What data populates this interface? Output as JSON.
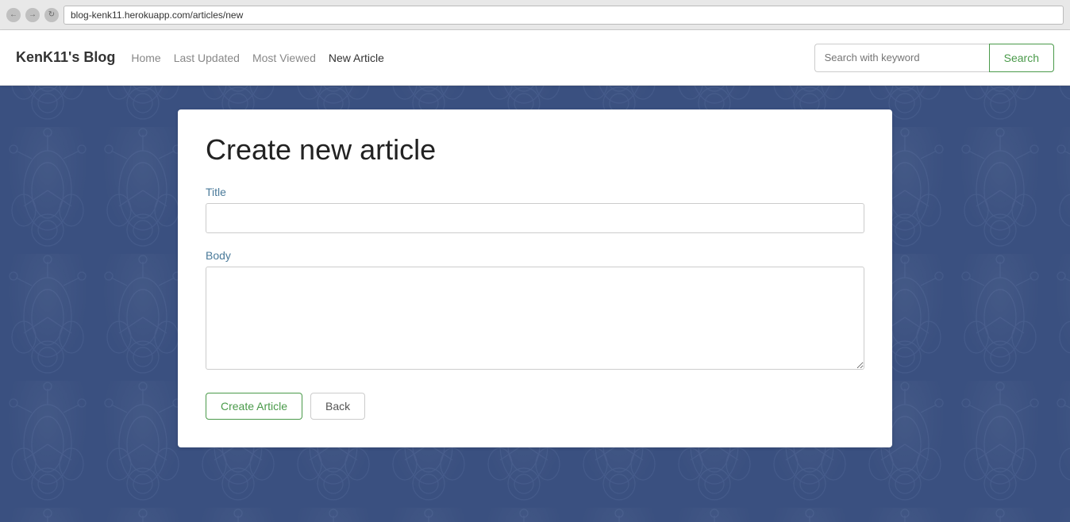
{
  "browser": {
    "url": "blog-kenk11.herokuapp.com/articles/new"
  },
  "navbar": {
    "brand": "KenK11's Blog",
    "links": [
      {
        "label": "Home",
        "active": false
      },
      {
        "label": "Last Updated",
        "active": false
      },
      {
        "label": "Most Viewed",
        "active": false
      },
      {
        "label": "New Article",
        "active": true
      }
    ],
    "search_placeholder": "Search with keyword",
    "search_button": "Search"
  },
  "form": {
    "title": "Create new article",
    "title_label": "Title",
    "title_placeholder": "",
    "body_label": "Body",
    "body_placeholder": "",
    "create_button": "Create Article",
    "back_button": "Back"
  }
}
